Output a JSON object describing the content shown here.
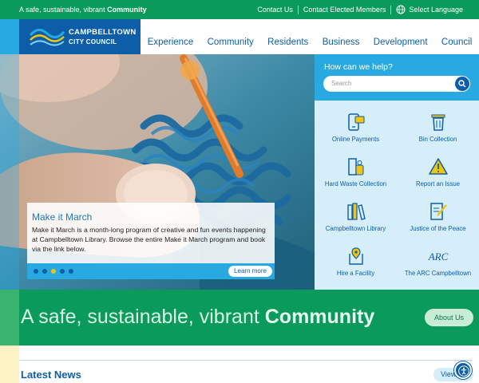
{
  "topbar": {
    "tagline_prefix": "A safe, sustainable, vibrant ",
    "tagline_bold": "Community",
    "links": [
      "Contact Us",
      "Contact Elected Members"
    ],
    "language": "Select Language"
  },
  "logo": {
    "line1": "CAMPBELLTOWN",
    "line2": "CITY COUNCIL"
  },
  "nav": [
    "Experience",
    "Community",
    "Residents",
    "Business",
    "Development",
    "Council"
  ],
  "hero": {
    "title": "Make it March",
    "description": "Make it March is a month-long program of creative and fun events happening at Campbelltown Library. Browse the entire Make it March program and book via the link below.",
    "cta": "Learn more",
    "slides_total": 5,
    "active_slide": 3
  },
  "help": {
    "heading": "How can we help?",
    "search_placeholder": "Search"
  },
  "services": [
    {
      "label": "Online Payments",
      "icon": "payment-icon"
    },
    {
      "label": "Bin Collection",
      "icon": "bin-icon"
    },
    {
      "label": "Hard Waste Collection",
      "icon": "hard-waste-icon"
    },
    {
      "label": "Report an Issue",
      "icon": "warning-icon"
    },
    {
      "label": "Campbelltown Library",
      "icon": "books-icon"
    },
    {
      "label": "Justice of the Peace",
      "icon": "document-pen-icon"
    },
    {
      "label": "Hire a Facility",
      "icon": "location-pin-icon"
    },
    {
      "label": "The ARC Campbelltown",
      "icon": "arc-logo-icon",
      "icon_text": "ARC"
    }
  ],
  "banner": {
    "text_prefix": "A safe, sustainable, vibrant ",
    "text_bold": "Community",
    "button": "About Us"
  },
  "news": {
    "heading": "Latest News",
    "view_button": "View"
  },
  "colors": {
    "green": "#0a9a5c",
    "blue": "#0d5ea8",
    "light_blue": "#29a9e1",
    "pale_blue": "#d6eefa"
  }
}
